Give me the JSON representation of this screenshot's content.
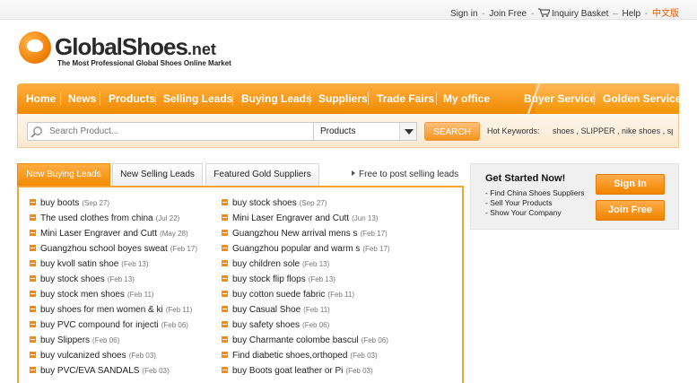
{
  "top_links": {
    "sign_in": "Sign in",
    "join_free": "Join Free",
    "inquiry_basket": "Inquiry Basket",
    "help": "Help",
    "chinese": "中文版"
  },
  "logo": {
    "name": "GlobalShoes",
    "suffix": ".net",
    "tagline": "The Most Professional Global Shoes Online Market"
  },
  "nav": {
    "items": [
      "Home",
      "News",
      "Products",
      "Selling Leads",
      "Buying Leads",
      "Suppliers",
      "Trade Fairs",
      "My office"
    ],
    "right_items": [
      "Buyer Service",
      "Golden Service"
    ]
  },
  "search": {
    "placeholder": "Search Product...",
    "category": "Products",
    "button": "SEARCH",
    "hot_label": "Hot Keywords:",
    "hot_keywords": "shoes , SLIPPER , nike shoes , spor"
  },
  "tabs": [
    "New Buying Leads",
    "New Selling Leads",
    "Featured Gold Suppliers"
  ],
  "post_link": "Free to post selling leads",
  "leads_left": [
    {
      "title": "buy boots",
      "date": "(Sep 27)"
    },
    {
      "title": "The used clothes from china",
      "date": "(Jul 22)"
    },
    {
      "title": "Mini Laser Engraver and Cutt",
      "date": "(May 28)"
    },
    {
      "title": "Guangzhou school boyes sweat",
      "date": "(Feb 17)"
    },
    {
      "title": "buy kvoll satin shoe",
      "date": "(Feb 13)"
    },
    {
      "title": "buy stock shoes",
      "date": "(Feb 13)"
    },
    {
      "title": "buy stock men shoes",
      "date": "(Feb 11)"
    },
    {
      "title": "buy shoes for men women & ki",
      "date": "(Feb 11)"
    },
    {
      "title": "buy PVC compound for injecti",
      "date": "(Feb 06)"
    },
    {
      "title": "buy Slippers",
      "date": "(Feb 06)"
    },
    {
      "title": "buy vulcanized shoes",
      "date": "(Feb 03)"
    },
    {
      "title": "buy PVC/EVA SANDALS",
      "date": "(Feb 03)"
    }
  ],
  "leads_right": [
    {
      "title": "buy stock shoes",
      "date": "(Sep 27)"
    },
    {
      "title": "Mini Laser Engraver and Cutt",
      "date": "(Jun 13)"
    },
    {
      "title": "Guangzhou New arrival mens s",
      "date": "(Feb 17)"
    },
    {
      "title": "Guangzhou popular and warm s",
      "date": "(Feb 17)"
    },
    {
      "title": "buy children sole",
      "date": "(Feb 13)"
    },
    {
      "title": "buy stock flip flops",
      "date": "(Feb 13)"
    },
    {
      "title": "buy cotton suede fabric",
      "date": "(Feb 11)"
    },
    {
      "title": "buy Casual Shoe",
      "date": "(Feb 11)"
    },
    {
      "title": "buy safety shoes",
      "date": "(Feb 06)"
    },
    {
      "title": "buy Charmante colombe bascul",
      "date": "(Feb 06)"
    },
    {
      "title": "Find diabetic shoes,orthoped",
      "date": "(Feb 03)"
    },
    {
      "title": "buy Boots goat leather or Pi",
      "date": "(Feb 03)"
    }
  ],
  "get_started": {
    "title": "Get Started Now!",
    "lines": [
      "- Find China Shoes Suppliers",
      "- Sell Your Products",
      "- Show Your Company"
    ],
    "sign_in_button": "Sign In",
    "join_button": "Join Free"
  }
}
